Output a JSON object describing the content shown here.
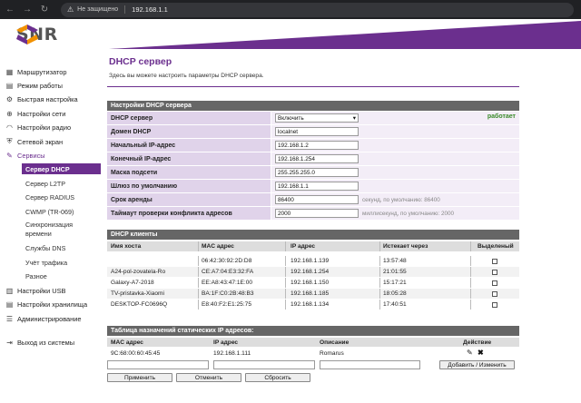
{
  "browser": {
    "security": "Не защищено",
    "url": "192.168.1.1"
  },
  "brand": {
    "logo_text": "SNR",
    "accent": "#6b2f8e",
    "orange": "#f29100"
  },
  "sidebar": {
    "items": [
      {
        "label": "Маршрутизатор",
        "icon": "dashboard-icon"
      },
      {
        "label": "Режим работы",
        "icon": "mode-icon"
      },
      {
        "label": "Быстрая настройка",
        "icon": "wand-icon"
      },
      {
        "label": "Настройки сети",
        "icon": "globe-icon"
      },
      {
        "label": "Настройки радио",
        "icon": "wifi-icon"
      },
      {
        "label": "Сетевой экран",
        "icon": "shield-icon"
      },
      {
        "label": "Сервисы",
        "icon": "wrench-icon"
      }
    ],
    "services": [
      "Сервер DHCP",
      "Сервер L2TP",
      "Сервер RADIUS",
      "CWMP (TR-069)",
      "Синхронизация",
      "времени",
      "Службы DNS",
      "Учёт трафика",
      "Разное"
    ],
    "bottom": [
      {
        "label": "Настройки USB",
        "icon": "usb-icon"
      },
      {
        "label": "Настройки хранилища",
        "icon": "storage-icon"
      },
      {
        "label": "Администрирование",
        "icon": "admin-icon"
      },
      {
        "label": "Выход из системы",
        "icon": "logout-icon"
      }
    ]
  },
  "page": {
    "title": "DHCP сервер",
    "description": "Здесь вы можете настроить параметры DHCP сервера."
  },
  "settings": {
    "header": "Настройки DHCP сервера",
    "dhcp_server_label": "DHCP сервер",
    "dhcp_server_value": "Включить",
    "status": "работает",
    "domain_label": "Домен DHCP",
    "domain_value": "localnet",
    "start_label": "Начальный IP-адрес",
    "start_value": "192.168.1.2",
    "end_label": "Конечный IP-адрес",
    "end_value": "192.168.1.254",
    "mask_label": "Маска подсети",
    "mask_value": "255.255.255.0",
    "gateway_label": "Шлюз по умолчанию",
    "gateway_value": "192.168.1.1",
    "lease_label": "Срок аренды",
    "lease_value": "86400",
    "lease_hint": "секунд, по умолчанию: 86400",
    "timeout_label": "Таймаут проверки конфликта адресов",
    "timeout_value": "2000",
    "timeout_hint": "миллисекунд, по умолчанию: 2000"
  },
  "clients": {
    "header": "DHCP клиенты",
    "columns": [
      "Имя хоста",
      "MAC адрес",
      "IP адрес",
      "Истекает через",
      "Выделеный"
    ],
    "rows": [
      [
        "",
        "06:42:30:92:2D:D8",
        "192.168.1.139",
        "13:57:48"
      ],
      [
        "A24-pol-zovatela-Ro",
        "CE:A7:04:E3:32:FA",
        "192.168.1.254",
        "21:01:55"
      ],
      [
        "Galaxy-A7-2018",
        "EE:A8:43:47:1E:00",
        "192.168.1.150",
        "15:17:21"
      ],
      [
        "TV-pristavka-Xiaomi",
        "BA:1F:C0:2B:48:B3",
        "192.168.1.185",
        "18:05:28"
      ],
      [
        "DESKTOP-FC0696Q",
        "E8:40:F2:E1:25:75",
        "192.168.1.134",
        "17:40:51"
      ]
    ]
  },
  "static": {
    "header": "Таблица назначений статических IP адресов:",
    "columns": [
      "MAC адрес",
      "IP адрес",
      "Описание",
      "Действие"
    ],
    "row": [
      "9C:68:00:60:45:45",
      "192.168.1.111",
      "Romarus"
    ],
    "add_button": "Добавить / Изменить"
  },
  "buttons": {
    "apply": "Применить",
    "cancel": "Отменить",
    "reset": "Сбросить"
  }
}
